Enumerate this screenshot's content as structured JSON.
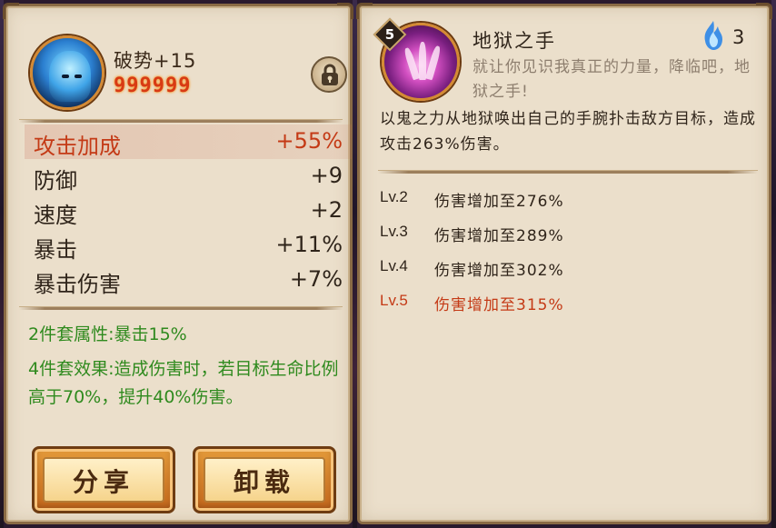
{
  "equipment": {
    "name": "破势+15",
    "stars_value": "999999",
    "stats": [
      {
        "label": "攻击加成",
        "value": "+55%"
      },
      {
        "label": "防御",
        "value": "+9"
      },
      {
        "label": "速度",
        "value": "+2"
      },
      {
        "label": "暴击",
        "value": "+11%"
      },
      {
        "label": "暴击伤害",
        "value": "+7%"
      }
    ],
    "set_bonus_2": "2件套属性:暴击15%",
    "set_bonus_4": "4件套效果:造成伤害时，若目标生命比例高于70%，提升40%伤害。",
    "share_label": "分享",
    "unload_label": "卸载"
  },
  "skill": {
    "level": "5",
    "name": "地狱之手",
    "cost": "3",
    "quote": "就让你见识我真正的力量，降临吧，地狱之手!",
    "description": "以鬼之力从地狱唤出自己的手腕扑击敌方目标，造成攻击263%伤害。",
    "upgrades": [
      {
        "level": "Lv.2",
        "effect": "伤害增加至276%"
      },
      {
        "level": "Lv.3",
        "effect": "伤害增加至289%"
      },
      {
        "level": "Lv.4",
        "effect": "伤害增加至302%"
      },
      {
        "level": "Lv.5",
        "effect": "伤害增加至315%"
      }
    ]
  },
  "colors": {
    "panel": "#ebdfcb",
    "highlight_red": "#c43a16",
    "set_green": "#2f8a1e"
  }
}
